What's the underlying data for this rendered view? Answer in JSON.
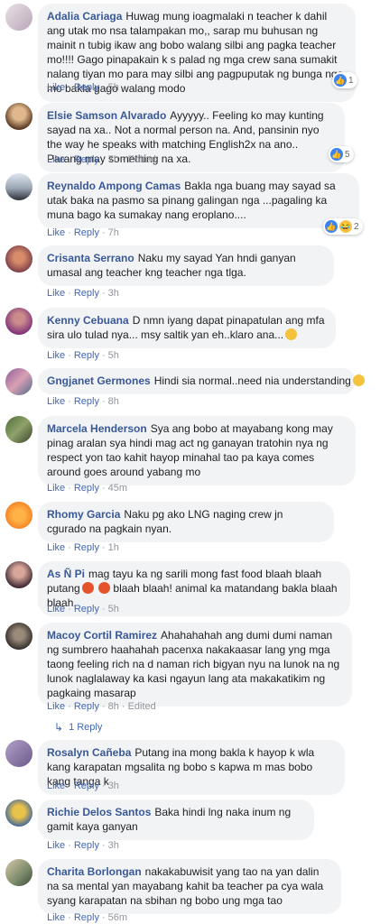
{
  "colors": {
    "link": "#4267b2",
    "author": "#385898",
    "bubble": "#f2f3f5",
    "meta": "#90949c",
    "like_reaction": "#3b82f6"
  },
  "comments": [
    {
      "author": "Adalia Cariaga",
      "text": "Huwag mung ioagmalaki n teacher k dahil ang utak mo nsa talampakan mo,, sarap mu buhusan ng mainit n tubig ikaw ang bobo walang silbi ang pagka teacher mo!!!! Gago pinapakain k s palad ng mga crew sana sumakit nalang tiyan mo para may silbi ang pagpuputak ng bunga nga mo bakla gago walang modo",
      "like": "Like",
      "reply": "Reply",
      "time": "5h",
      "edited": "",
      "reactions": {
        "icons": [
          "like-reaction-icon"
        ],
        "count": "1"
      }
    },
    {
      "author": "Elsie Samson Alvarado",
      "text": "Ayyyyy.. Feeling ko may kunting sayad na xa.. Not a normal person na. And, pansinin nyo the way he speaks with matching English2x na ano.. Parang may something na xa.",
      "like": "Like",
      "reply": "Reply",
      "time": "7h",
      "edited": "Edited",
      "reactions": {
        "icons": [
          "like-reaction-icon"
        ],
        "count": "5"
      }
    },
    {
      "author": "Reynaldo Ampong Camas",
      "text": "Bakla nga buang may sayad sa utak baka na pasmo sa pinang galingan nga ...pagaling ka muna bago ka sumakay nang eroplano....",
      "like": "Like",
      "reply": "Reply",
      "time": "7h",
      "edited": "",
      "reactions": {
        "icons": [
          "like-reaction-icon",
          "haha-reaction-icon"
        ],
        "count": "2"
      }
    },
    {
      "author": "Crisanta Serrano",
      "text": "Naku my sayad Yan hndi ganyan umasal ang teacher kng teacher nga tlga.",
      "like": "Like",
      "reply": "Reply",
      "time": "3h",
      "edited": ""
    },
    {
      "author": "Kenny Cebuana",
      "text": "D nmn iyang dapat pinapatulan ang mfa sira ulo tulad nya... msy saltik yan eh..klaro ana...",
      "like": "Like",
      "reply": "Reply",
      "time": "5h",
      "edited": "",
      "emoji": "grinning-emoji"
    },
    {
      "author": "Gngjanet Germones",
      "text": "Hindi sia normal..need nia understanding",
      "like": "Like",
      "reply": "Reply",
      "time": "8h",
      "edited": "",
      "emoji": "sad-emoji"
    },
    {
      "author": "Marcela Henderson",
      "text": "Sya ang bobo at mayabang kong may pinag aralan sya hindi mag act ng ganayan tratohin nya ng respect yon tao kahit hayop minahal tao pa kaya comes around goes around yabang mo",
      "like": "Like",
      "reply": "Reply",
      "time": "45m",
      "edited": ""
    },
    {
      "author": "Rhomy Garcia",
      "text": "Naku pg ako LNG naging crew jn cgurado na pagkain nyan.",
      "like": "Like",
      "reply": "Reply",
      "time": "1h",
      "edited": ""
    },
    {
      "author": "As Ñ Pi",
      "text_before": "mag tayu ka ng sarili mong fast food blaah blaah putang",
      "text_after": "blaah blaah! animal ka matandang bakla blaah blaah.",
      "like": "Like",
      "reply": "Reply",
      "time": "5h",
      "edited": ""
    },
    {
      "author": "Macoy Cortil Ramirez",
      "text": "Ahahahahah ang dumi dumi naman ng sumbrero haahahah pacenxa nakakaasar lang yng mga taong feeling rich na d naman rich bigyan nyu na lunok na ng lunok naglalaway ka kasi ngayun lang ata makakatikim ng pagkaing masarap",
      "like": "Like",
      "reply": "Reply",
      "time": "8h",
      "edited": "Edited",
      "replies_link": "1 Reply"
    },
    {
      "author": "Rosalyn Cañeba",
      "text": "Putang ina mong bakla k hayop k wla kang karapatan mgsalita ng bobo s kapwa m mas bobo kang tanga k",
      "like": "Like",
      "reply": "Reply",
      "time": "3h",
      "edited": ""
    },
    {
      "author": "Richie Delos Santos",
      "text": "Baka hindi lng naka inum ng gamit kaya ganyan",
      "like": "Like",
      "reply": "Reply",
      "time": "3h",
      "edited": ""
    },
    {
      "author": "Charita Borlongan",
      "text": "nakakabuwisit yang tao na yan dalin na sa mental yan mayabang kahit ba teacher pa cya wala syang karapatan na sbihan ng bobo ung mga tao",
      "like": "Like",
      "reply": "Reply",
      "time": "56m",
      "edited": ""
    }
  ]
}
